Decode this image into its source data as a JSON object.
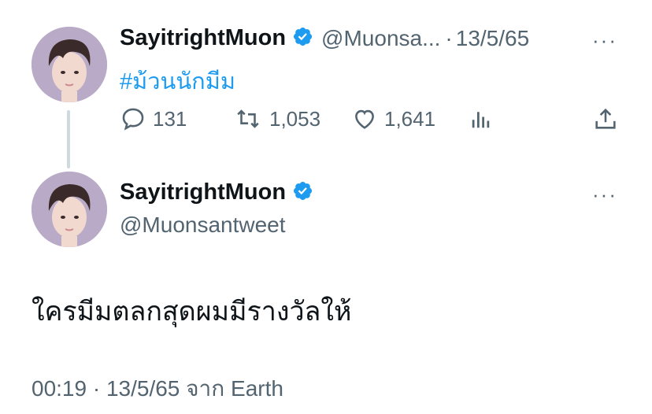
{
  "tweet1": {
    "display_name": "SayitrightMuon",
    "handle_truncated": "@Muonsa...",
    "separator": "·",
    "date": "13/5/65",
    "hashtag": "#ม้วนนักมีม",
    "more": "···",
    "actions": {
      "replies": "131",
      "retweets": "1,053",
      "likes": "1,641"
    }
  },
  "tweet2": {
    "display_name": "SayitrightMuon",
    "handle": "@Muonsantweet",
    "more": "···",
    "text": "ใครมีมตลกสุดผมมีรางวัลให้",
    "timestamp": "00:19 · 13/5/65 จาก Earth"
  },
  "colors": {
    "accent": "#1d9bf0",
    "secondary_text": "#536471",
    "thread_line": "#cfd9de"
  }
}
